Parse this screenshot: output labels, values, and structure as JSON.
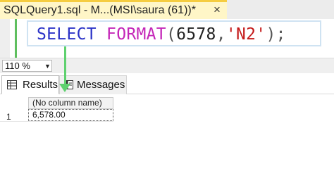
{
  "window": {
    "tab_title": "SQLQuery1.sql - M...(MSI\\saura (61))*",
    "close_glyph": "×"
  },
  "editor": {
    "tokens": [
      {
        "text": "SELECT",
        "role": "keyword",
        "color": "#2b33c7"
      },
      {
        "text": " ",
        "role": "space"
      },
      {
        "text": "FORMAT",
        "role": "function",
        "color": "#c426b8"
      },
      {
        "text": "(",
        "role": "punct"
      },
      {
        "text": "6578",
        "role": "number"
      },
      {
        "text": ",",
        "role": "punct"
      },
      {
        "text": "'N2'",
        "role": "string",
        "color": "#c41a1a"
      },
      {
        "text": ");",
        "role": "punct"
      }
    ]
  },
  "zoom": {
    "value": "110 %"
  },
  "results": {
    "tabs": [
      {
        "label": "Results",
        "icon": "grid-icon",
        "active": true
      },
      {
        "label": "Messages",
        "icon": "messages-icon",
        "active": false
      }
    ],
    "columns": [
      "(No column name)"
    ],
    "rows": [
      {
        "num": "1",
        "cells": [
          "6,578.00"
        ]
      }
    ]
  },
  "colors": {
    "tab_active": "#fff6c7",
    "tab_border": "#f5cc40",
    "annotation_arrow": "#5fd16f"
  }
}
